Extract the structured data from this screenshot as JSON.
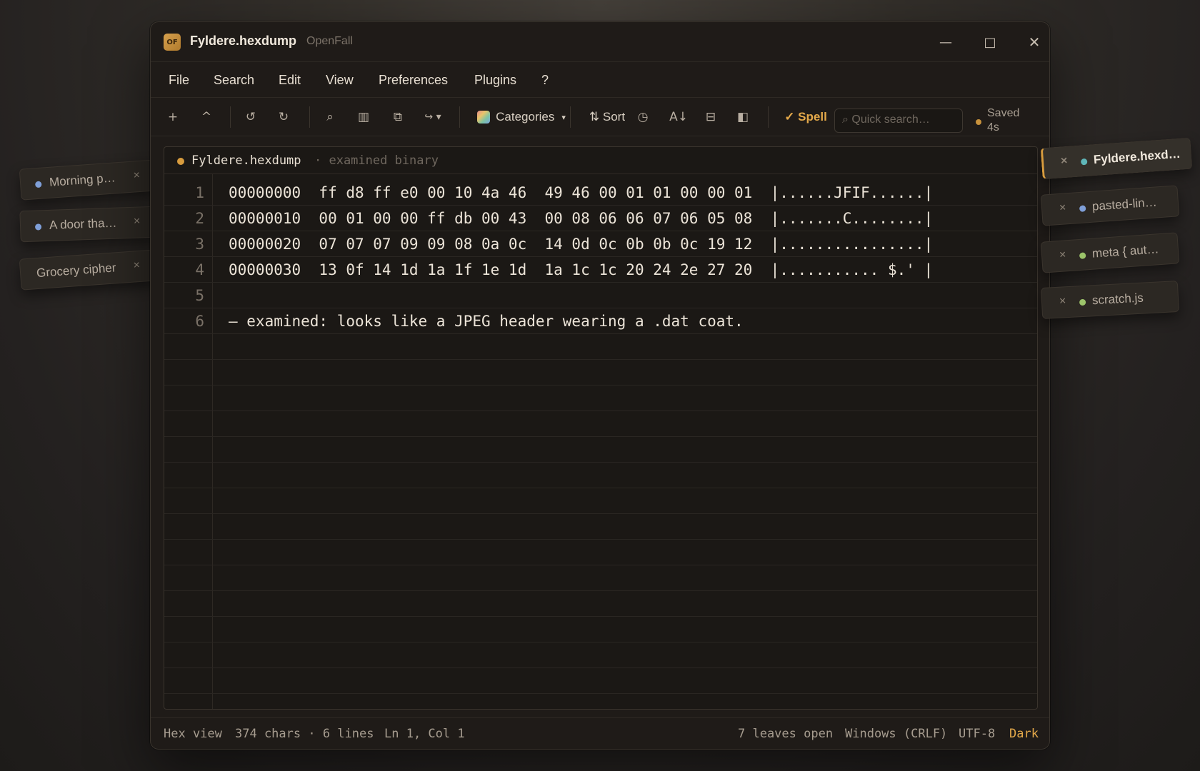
{
  "window": {
    "title": "Fyldere.hexdump",
    "app": "OpenFall",
    "badge": "OF",
    "minimize": "—",
    "maximize": "□",
    "close": "✕"
  },
  "menu": [
    "File",
    "Search",
    "Edit",
    "View",
    "Preferences",
    "Plugins",
    "?"
  ],
  "toolbar": {
    "new": "+",
    "up": "^",
    "undo": "↺",
    "redo": "↻",
    "find": "⌕",
    "columns": "▥",
    "copy": "⧉",
    "wrap": "↪ ▾",
    "categories": "Categories",
    "categories_caret": "▾",
    "sort": "⇅ Sort",
    "history": "◷",
    "az": "A↓",
    "split": "⊟",
    "panel": "◧",
    "spell": "✓ Spell",
    "search_placeholder": "⌕ Quick search…",
    "saved": "Saved 4s"
  },
  "editor": {
    "file": "Fyldere.hexdump",
    "subtitle": "· examined binary",
    "lines": [
      {
        "n": "1",
        "text": "00000000  ff d8 ff e0 00 10 4a 46  49 46 00 01 01 00 00 01  |......JFIF......|"
      },
      {
        "n": "2",
        "text": "00000010  00 01 00 00 ff db 00 43  00 08 06 06 07 06 05 08  |.......C........|"
      },
      {
        "n": "3",
        "text": "00000020  07 07 07 09 09 08 0a 0c  14 0d 0c 0b 0b 0c 19 12  |................|"
      },
      {
        "n": "4",
        "text": "00000030  13 0f 14 1d 1a 1f 1e 1d  1a 1c 1c 20 24 2e 27 20  |........... $.' |"
      },
      {
        "n": "5",
        "text": ""
      },
      {
        "n": "6",
        "text": "— examined: looks like a JPEG header wearing a .dat coat."
      }
    ]
  },
  "status": {
    "mode": "Hex view",
    "counts": "374 chars · 6 lines",
    "pos": "Ln 1, Col 1",
    "leaves": "7 leaves open",
    "eol": "Windows (CRLF)",
    "enc": "UTF-8",
    "theme": "Dark"
  },
  "left_leaves": [
    {
      "label": "Morning p…",
      "dot": "#7f9fd8"
    },
    {
      "label": "A door tha…",
      "dot": "#7f9fd8"
    },
    {
      "label": "Grocery cipher",
      "dot": ""
    }
  ],
  "right_leaves": [
    {
      "label": "Fyldere.hexd…",
      "dot": "#5fb6b8",
      "active": true
    },
    {
      "label": "pasted-lin…",
      "dot": "#7f9fd8"
    },
    {
      "label": "meta { aut…",
      "dot": "#9cc46a"
    },
    {
      "label": "scratch.js",
      "dot": "#9cc46a"
    }
  ],
  "close_glyph": "×"
}
